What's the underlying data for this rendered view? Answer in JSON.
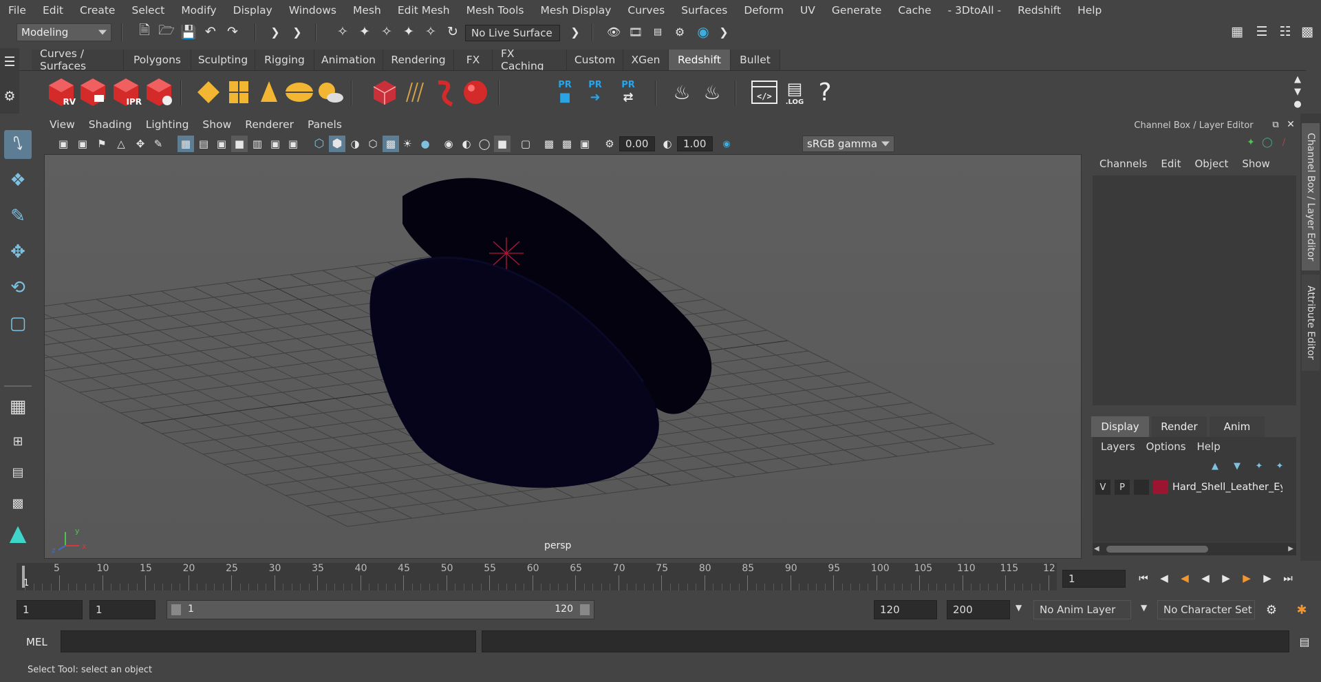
{
  "menu": [
    "File",
    "Edit",
    "Create",
    "Select",
    "Modify",
    "Display",
    "Windows",
    "Mesh",
    "Edit Mesh",
    "Mesh Tools",
    "Mesh Display",
    "Curves",
    "Surfaces",
    "Deform",
    "UV",
    "Generate",
    "Cache",
    "- 3DtoAll -",
    "Redshift",
    "Help"
  ],
  "status": {
    "mode": "Modeling",
    "live_surface": "No Live Surface"
  },
  "shelf_tabs": [
    "Curves / Surfaces",
    "Polygons",
    "Sculpting",
    "Rigging",
    "Animation",
    "Rendering",
    "FX",
    "FX Caching",
    "Custom",
    "XGen",
    "Redshift",
    "Bullet"
  ],
  "shelf_active": "Redshift",
  "shelf_labels": {
    "rv": "RV",
    "ipr": "IPR",
    "pr": "PR",
    "log": ".LOG",
    "help": "?"
  },
  "viewport": {
    "menus": [
      "View",
      "Shading",
      "Lighting",
      "Show",
      "Renderer",
      "Panels"
    ],
    "exposure": "0.00",
    "gamma": "1.00",
    "color_space": "sRGB gamma",
    "camera_label": "persp",
    "axis_x": "x",
    "axis_y": "y",
    "axis_z": "z"
  },
  "channel_box": {
    "title": "Channel Box / Layer Editor",
    "menus": [
      "Channels",
      "Edit",
      "Object",
      "Show"
    ],
    "tabs": [
      "Display",
      "Render",
      "Anim"
    ],
    "active_tab": "Display",
    "layer_menus": [
      "Layers",
      "Options",
      "Help"
    ],
    "layer": {
      "v": "V",
      "p": "P",
      "name": "Hard_Shell_Leather_Ey",
      "color": "#9c1530"
    }
  },
  "side_tabs": [
    "Channel Box / Layer Editor",
    "Attribute Editor"
  ],
  "timeline": {
    "ticks": [
      "5",
      "10",
      "15",
      "20",
      "25",
      "30",
      "35",
      "40",
      "45",
      "50",
      "55",
      "60",
      "65",
      "70",
      "75",
      "80",
      "85",
      "90",
      "95",
      "100",
      "105",
      "110",
      "115",
      "12"
    ],
    "current_frame_marker": "1",
    "current_frame": "1"
  },
  "range": {
    "start": "1",
    "anim_start": "1",
    "slider_start": "1",
    "slider_end": "120",
    "end": "120",
    "anim_end": "200",
    "anim_layer": "No Anim Layer",
    "character_set": "No Character Set"
  },
  "cmd": {
    "label": "MEL"
  },
  "help_line": "Select Tool: select an object",
  "colors": {
    "accent": "#5d5d5d",
    "redshift_red": "#d42a2a",
    "shelf_yellow": "#f2b632",
    "pr_blue": "#2aa4e6",
    "mesh": "#03020e"
  }
}
